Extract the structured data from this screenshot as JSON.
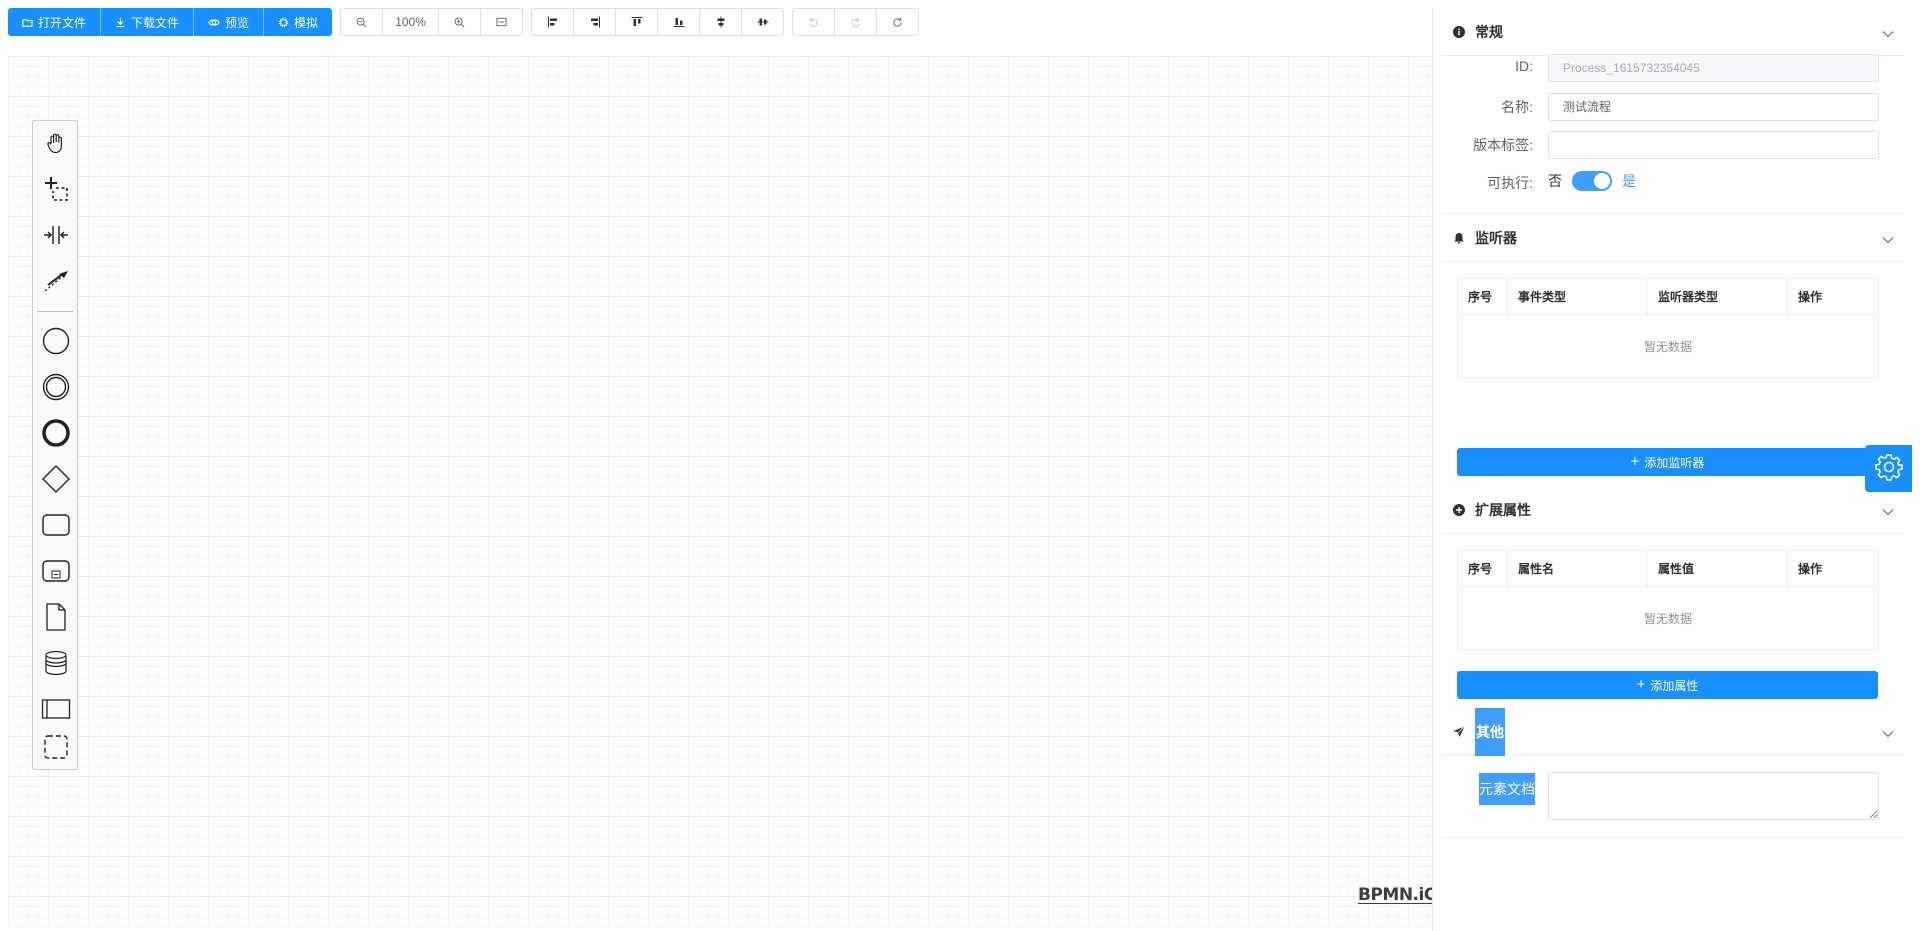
{
  "toolbar": {
    "open_file": "打开文件",
    "download_file": "下载文件",
    "preview": "预览",
    "simulate": "模拟",
    "zoom_level": "100%",
    "icons": {
      "open_file": "folder-open-icon",
      "download_file": "download-icon",
      "preview": "eye-icon",
      "simulate": "cpu-icon",
      "zoom_out": "zoom-out-icon",
      "zoom_in": "zoom-in-icon",
      "zoom_reset": "fit-screen-icon",
      "align_left": "align-left-icon",
      "align_right": "align-right-icon",
      "align_top": "align-top-icon",
      "align_bottom": "align-bottom-icon",
      "align_middle": "align-middle-icon",
      "align_center": "align-center-icon",
      "undo": "undo-icon",
      "redo": "redo-icon",
      "refresh": "refresh-icon"
    }
  },
  "palette": {
    "tools": [
      "hand-tool-icon",
      "lasso-tool-icon",
      "space-tool-icon",
      "global-connect-tool-icon",
      "start-event-icon",
      "intermediate-event-icon",
      "end-event-icon",
      "exclusive-gateway-icon",
      "task-icon",
      "subprocess-icon",
      "data-object-icon",
      "data-store-icon",
      "pool-icon",
      "group-icon"
    ]
  },
  "canvas": {
    "logo_text": "BPMN.iO"
  },
  "panel": {
    "general": {
      "title": "常规",
      "id_label": "ID:",
      "id_value": "Process_1615732354045",
      "name_label": "名称:",
      "name_value": "测试流程",
      "version_label": "版本标签:",
      "version_value": "",
      "executable_label": "可执行:",
      "executable_off": "否",
      "executable_on": "是",
      "executable": true
    },
    "listeners": {
      "title": "监听器",
      "columns": [
        "序号",
        "事件类型",
        "监听器类型",
        "操作"
      ],
      "empty_text": "暂无数据",
      "add_button": "添加监听器"
    },
    "extensions": {
      "title": "扩展属性",
      "columns": [
        "序号",
        "属性名",
        "属性值",
        "操作"
      ],
      "empty_text": "暂无数据",
      "add_button": "添加属性"
    },
    "other": {
      "title": "其他",
      "documentation_label": "元素文档",
      "documentation_value": ""
    }
  },
  "colors": {
    "primary": "#1890ff",
    "switch_on": "#409eff",
    "selection_highlight": "#409eff"
  }
}
